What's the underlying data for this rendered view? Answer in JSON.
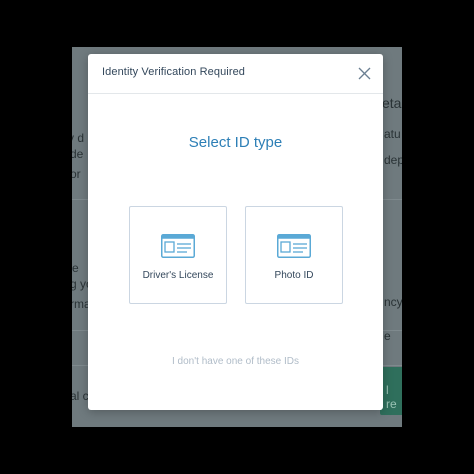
{
  "modal": {
    "title": "Identity Verification Required",
    "close_icon": "close-icon",
    "heading": "Select ID type",
    "options": [
      {
        "label": "Driver's License",
        "icon": "id-card-icon"
      },
      {
        "label": "Photo ID",
        "icon": "id-card-icon"
      }
    ],
    "no_id_link": "I don't have one of these IDs"
  },
  "background": {
    "fragments": [
      "y d",
      "de",
      "or",
      "re",
      "g yo",
      "rma",
      "al c",
      "eta",
      "atu",
      "dep",
      "ncy",
      "e",
      "l re"
    ]
  },
  "colors": {
    "accent": "#2d7fb6",
    "text": "#33475b",
    "muted": "#b0bcc8",
    "card_border": "#cbd6e2",
    "icon_blue": "#5aa9d6",
    "overlay": "#6f7a7e"
  }
}
